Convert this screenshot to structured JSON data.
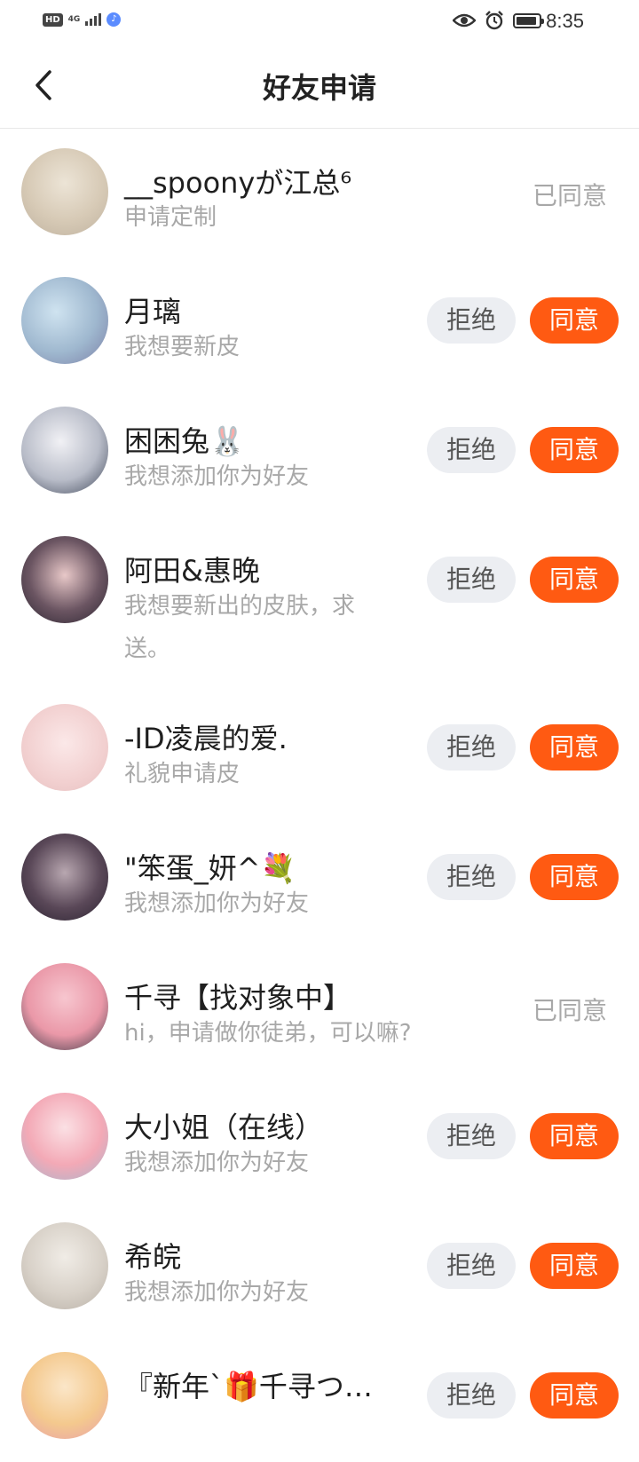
{
  "status_bar": {
    "hd": "HD",
    "net": "4G",
    "time": "8:35"
  },
  "header": {
    "title": "好友申请"
  },
  "actions": {
    "reject": "拒绝",
    "accept": "同意",
    "agreed": "已同意"
  },
  "requests": [
    {
      "name": "__spoonyが江总⁶",
      "message": "申请定制",
      "status": "agreed"
    },
    {
      "name": "月璃",
      "message": "我想要新皮",
      "status": "pending"
    },
    {
      "name": "困困兔🐰",
      "message": "我想添加你为好友",
      "status": "pending"
    },
    {
      "name": "阿田&惠晚",
      "message": "我想要新出的皮肤，求送。",
      "status": "pending"
    },
    {
      "name": "-ID凌晨的爱.",
      "message": "礼貌申请皮",
      "status": "pending"
    },
    {
      "name": "\"笨蛋_妍^💐",
      "message": "我想添加你为好友",
      "status": "pending"
    },
    {
      "name": "千寻【找对象中】",
      "message": "hi，申请做你徒弟，可以嘛?",
      "status": "agreed"
    },
    {
      "name": "大小姐（在线）",
      "message": "我想添加你为好友",
      "status": "pending"
    },
    {
      "name": "希皖",
      "message": "我想添加你为好友",
      "status": "pending"
    },
    {
      "name": "『新年`🎁千寻つ…",
      "message": "",
      "status": "pending"
    }
  ],
  "colors": {
    "accent": "#ff5a12",
    "reject_bg": "#eceef2",
    "muted_text": "#a8a8a8"
  }
}
